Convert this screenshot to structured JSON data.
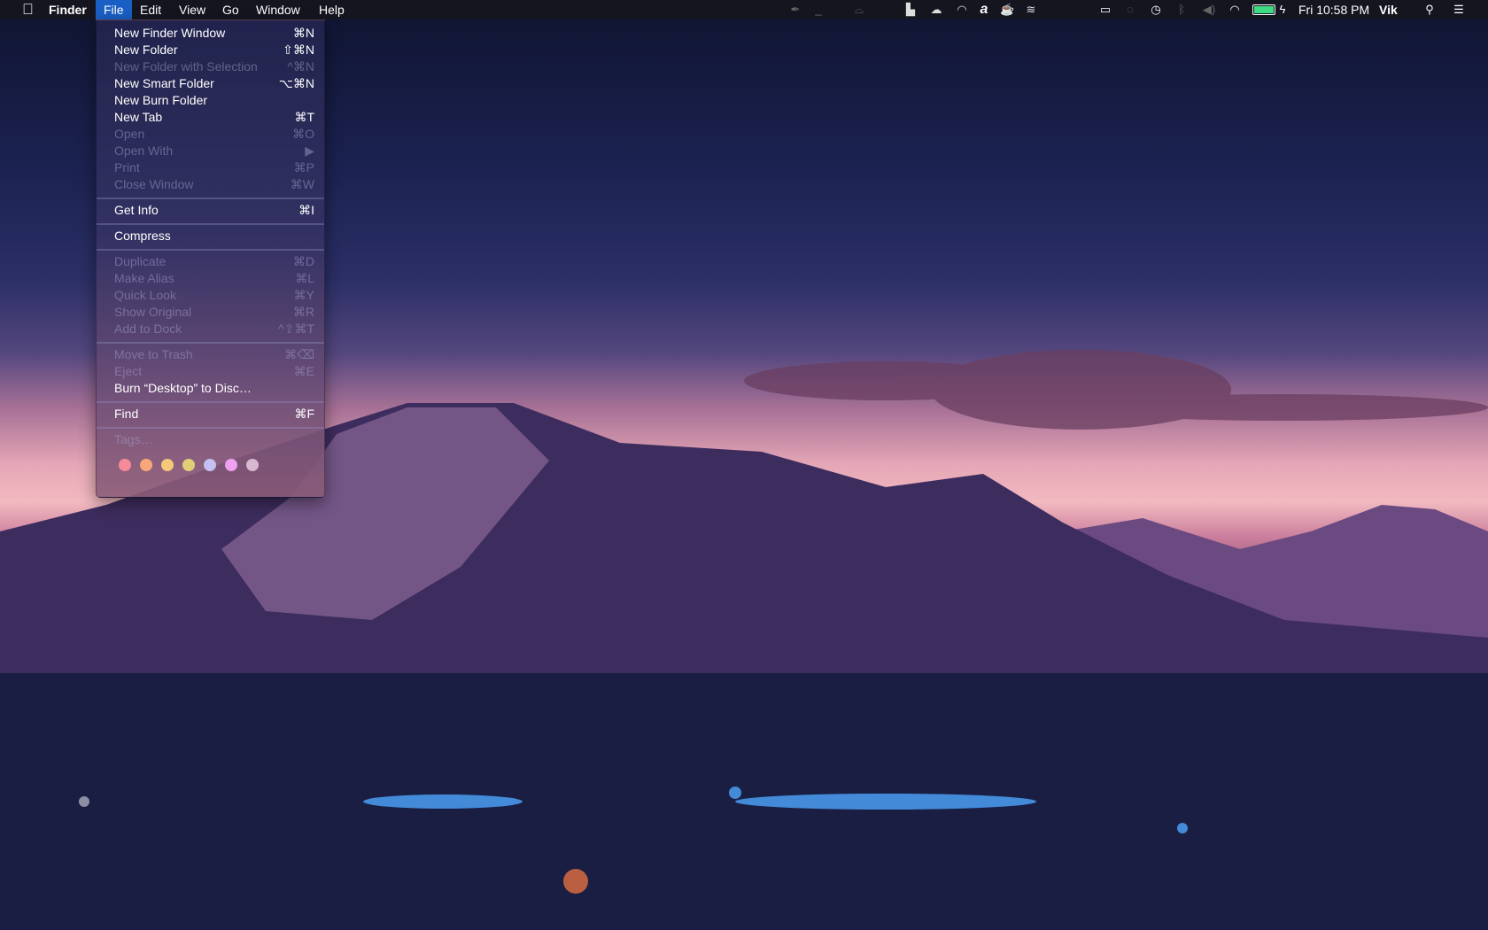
{
  "menubar": {
    "apple_icon": "apple-logo",
    "app": "Finder",
    "menus": [
      "File",
      "Edit",
      "View",
      "Go",
      "Window",
      "Help"
    ],
    "clock": "Fri 10:58 PM",
    "user": "Vik",
    "status_icons": [
      "pen-icon",
      "dash-icon",
      "cloud-outline-icon",
      "drive-icon",
      "cloud-icon",
      "headphones-icon",
      "a-icon",
      "coffee-icon",
      "wave-icon",
      "airplay-icon",
      "clock-disabled-icon",
      "time-machine-icon",
      "bluetooth-icon",
      "volume-icon",
      "wifi-icon",
      "battery-icon",
      "search-icon",
      "notifications-icon"
    ],
    "battery_color": "#3ddc84"
  },
  "file_menu": {
    "group1": [
      {
        "label": "New Finder Window",
        "shortcut": "⌘N",
        "enabled": true
      },
      {
        "label": "New Folder",
        "shortcut": "⇧⌘N",
        "enabled": true
      },
      {
        "label": "New Folder with Selection",
        "shortcut": "^⌘N",
        "enabled": false
      },
      {
        "label": "New Smart Folder",
        "shortcut": "⌥⌘N",
        "enabled": true
      },
      {
        "label": "New Burn Folder",
        "shortcut": "",
        "enabled": true
      },
      {
        "label": "New Tab",
        "shortcut": "⌘T",
        "enabled": true
      },
      {
        "label": "Open",
        "shortcut": "⌘O",
        "enabled": false
      },
      {
        "label": "Open With",
        "shortcut": "▶",
        "enabled": false
      },
      {
        "label": "Print",
        "shortcut": "⌘P",
        "enabled": false
      },
      {
        "label": "Close Window",
        "shortcut": "⌘W",
        "enabled": false
      }
    ],
    "group2": [
      {
        "label": "Get Info",
        "shortcut": "⌘I",
        "enabled": true
      }
    ],
    "group3": [
      {
        "label": "Compress",
        "shortcut": "",
        "enabled": true
      }
    ],
    "group4": [
      {
        "label": "Duplicate",
        "shortcut": "⌘D",
        "enabled": false
      },
      {
        "label": "Make Alias",
        "shortcut": "⌘L",
        "enabled": false
      },
      {
        "label": "Quick Look",
        "shortcut": "⌘Y",
        "enabled": false
      },
      {
        "label": "Show Original",
        "shortcut": "⌘R",
        "enabled": false
      },
      {
        "label": "Add to Dock",
        "shortcut": "^⇧⌘T",
        "enabled": false
      }
    ],
    "group5": [
      {
        "label": "Move to Trash",
        "shortcut": "⌘⌫",
        "enabled": false
      },
      {
        "label": "Eject",
        "shortcut": "⌘E",
        "enabled": false
      },
      {
        "label": "Burn “Desktop” to Disc…",
        "shortcut": "",
        "enabled": true
      }
    ],
    "group6": [
      {
        "label": "Find",
        "shortcut": "⌘F",
        "enabled": true
      }
    ],
    "tags_label": "Tags…",
    "tag_colors": [
      "#f58a9a",
      "#f7a878",
      "#f5c978",
      "#e1cf78",
      "#c4c0f0",
      "#f0a0f0",
      "#d8b8d0"
    ]
  }
}
